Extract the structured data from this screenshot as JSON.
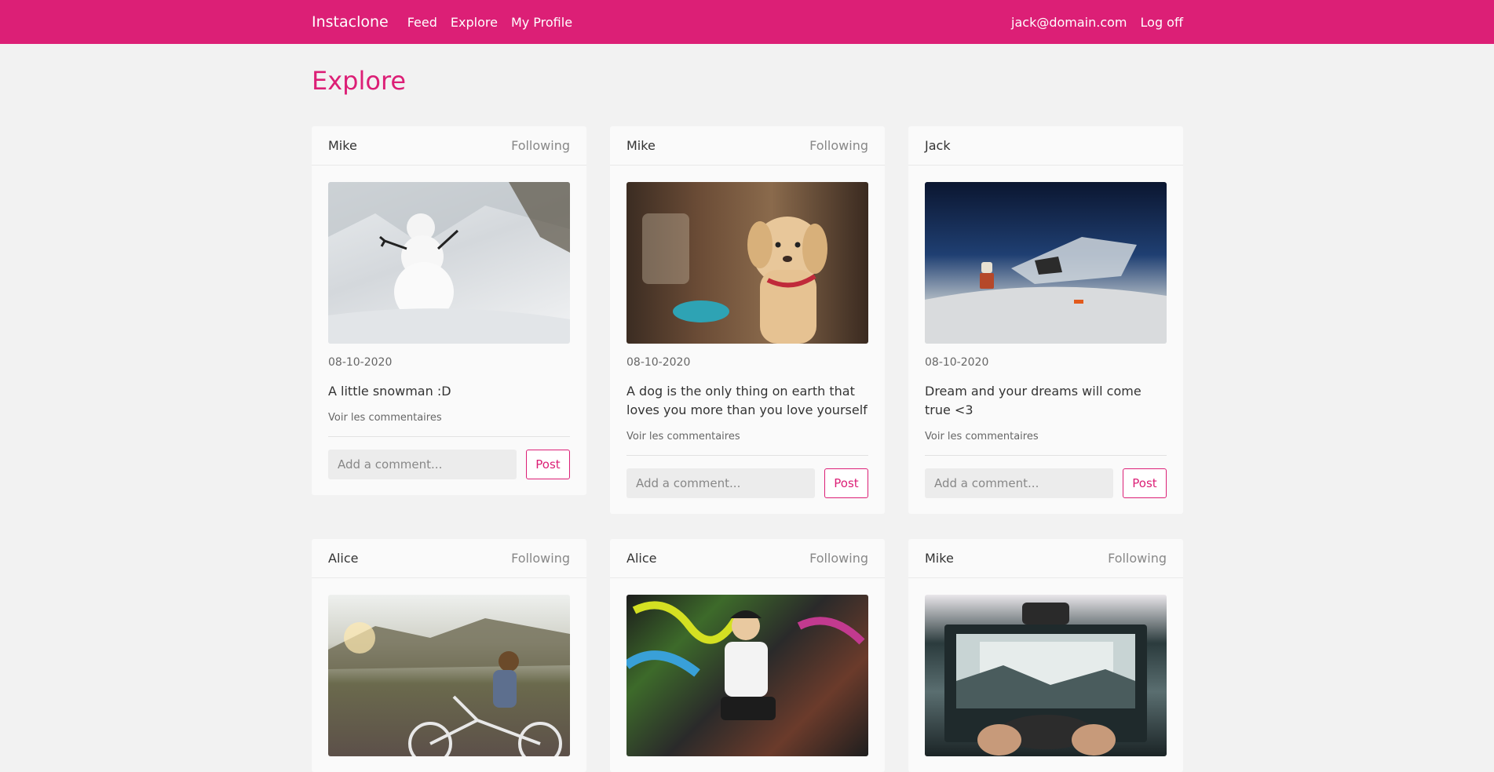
{
  "navbar": {
    "brand": "Instaclone",
    "links": [
      "Feed",
      "Explore",
      "My Profile"
    ],
    "user_email": "jack@domain.com",
    "logoff": "Log off"
  },
  "page": {
    "title": "Explore"
  },
  "posts": [
    {
      "author": "Mike",
      "follow_status": "Following",
      "photo": "snowman-photo",
      "date": "08-10-2020",
      "caption": "A little snowman :D",
      "see_comments": "Voir les commentaires",
      "comment_placeholder": "Add a comment...",
      "post_label": "Post"
    },
    {
      "author": "Mike",
      "follow_status": "Following",
      "photo": "puppy-photo",
      "date": "08-10-2020",
      "caption": "A dog is the only thing on earth that loves you more than you love yourself",
      "see_comments": "Voir les commentaires",
      "comment_placeholder": "Add a comment...",
      "post_label": "Post"
    },
    {
      "author": "Jack",
      "follow_status": "",
      "photo": "lego-astronaut-photo",
      "date": "08-10-2020",
      "caption": "Dream and your dreams will come true <3",
      "see_comments": "Voir les commentaires",
      "comment_placeholder": "Add a comment...",
      "post_label": "Post"
    },
    {
      "author": "Alice",
      "follow_status": "Following",
      "photo": "bicycle-girl-photo"
    },
    {
      "author": "Alice",
      "follow_status": "Following",
      "photo": "graffiti-girl-photo"
    },
    {
      "author": "Mike",
      "follow_status": "Following",
      "photo": "gaming-photo"
    }
  ],
  "colors": {
    "accent": "#dc1f76",
    "background": "#f2f2f2",
    "card": "#fafafa"
  }
}
